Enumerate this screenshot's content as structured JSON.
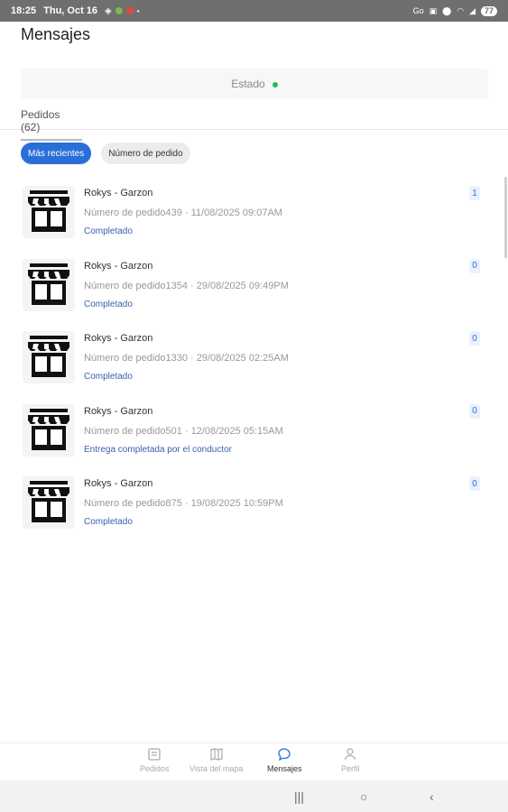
{
  "status_bar": {
    "time": "18:25",
    "date": "Thu, Oct 16",
    "battery": "77"
  },
  "page": {
    "title": "Mensajes"
  },
  "estado": {
    "label": "Estado",
    "indicator_color": "#1fbf55"
  },
  "tabs": [
    {
      "label": "Pedidos (62)"
    }
  ],
  "filters": [
    {
      "label": "Más recientes",
      "active": true
    },
    {
      "label": "Número de pedido",
      "active": false
    }
  ],
  "conversations": [
    {
      "name": "Rokys - Garzon",
      "subtitle": "Número de pedido439 · 11/08/2025 09:07AM",
      "status": "Completado",
      "count": "1",
      "icon": "store-icon"
    },
    {
      "name": "Rokys - Garzon",
      "subtitle": "Número de pedido1354 · 29/08/2025 09:49PM",
      "status": "Completado",
      "count": "0",
      "icon": "store-icon"
    },
    {
      "name": "Rokys - Garzon",
      "subtitle": "Número de pedido1330 · 29/08/2025 02:25AM",
      "status": "Completado",
      "count": "0",
      "icon": "store-icon"
    },
    {
      "name": "Rokys - Garzon",
      "subtitle": "Número de pedido501 · 12/08/2025 05:15AM",
      "status": "Entrega completada por el conductor",
      "count": "0",
      "icon": "store-icon"
    },
    {
      "name": "Rokys - Garzon",
      "subtitle": "Número de pedido875 · 19/08/2025 10:59PM",
      "status": "Completado",
      "count": "0",
      "icon": "store-icon"
    }
  ],
  "bottom_nav": [
    {
      "label": "Pedidos",
      "icon": "orders-icon",
      "active": false
    },
    {
      "label": "Vista del mapa",
      "icon": "map-icon",
      "active": false
    },
    {
      "label": "Mensajes",
      "icon": "chat-bubble-icon",
      "active": true
    },
    {
      "label": "Perfil",
      "icon": "person-icon",
      "active": false
    }
  ],
  "colors": {
    "accent": "#2a6fd8",
    "status_text": "#3a5fb0"
  }
}
